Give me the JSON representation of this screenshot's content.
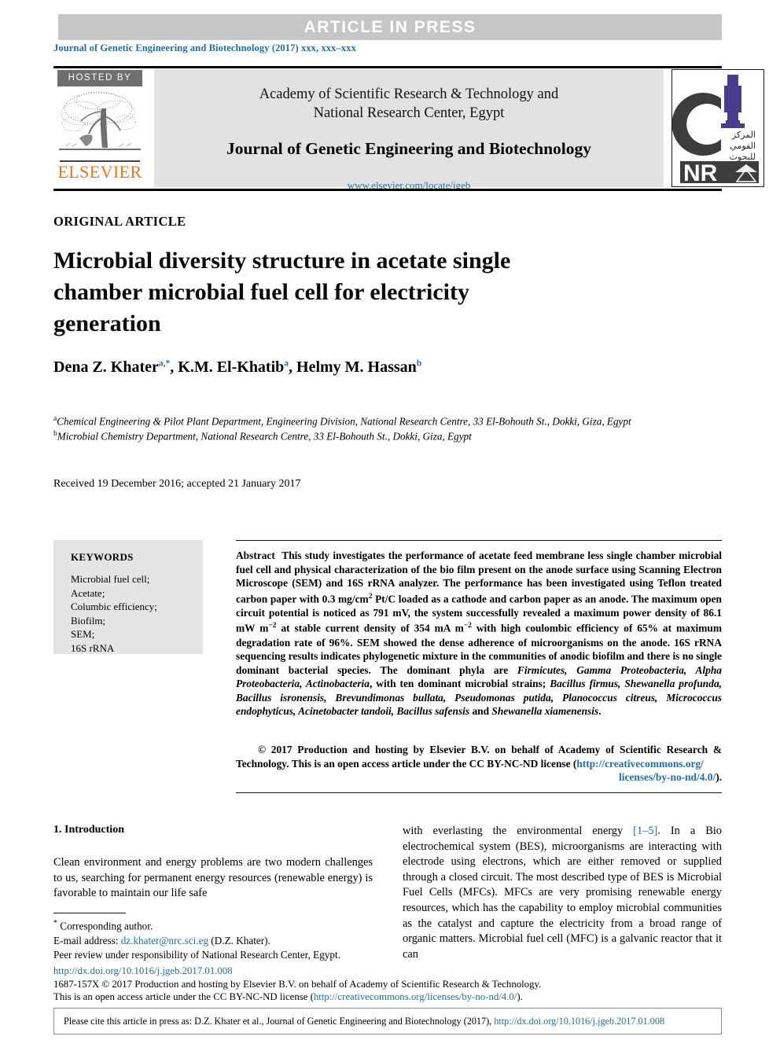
{
  "banner": {
    "text": "ARTICLE IN PRESS",
    "bg_color": "#c6c6c6"
  },
  "journal_reference": "Journal of Genetic Engineering and Biotechnology (2017) xxx, xxx–xxx",
  "masthead": {
    "hosted_by_label": "HOSTED BY",
    "publisher_name": "ELSEVIER",
    "society_line1": "Academy of Scientific Research & Technology and",
    "society_line2": "National Research Center, Egypt",
    "journal_title": "Journal of Genetic Engineering and Biotechnology",
    "journal_url": "www.elsevier.com/locate/jgeb",
    "nrc_arabic_line1": "المركز",
    "nrc_arabic_line2": "القومي",
    "nrc_arabic_line3": "للبحوث",
    "nrc_acronym": "NRC"
  },
  "article": {
    "type_label": "ORIGINAL ARTICLE",
    "title": "Microbial diversity structure in acetate single chamber microbial fuel cell for electricity generation",
    "authors": [
      {
        "name": "Dena Z. Khater",
        "marks": "a,*"
      },
      {
        "name": "K.M. El-Khatib",
        "marks": "a"
      },
      {
        "name": "Helmy M. Hassan",
        "marks": "b"
      }
    ],
    "affiliations": [
      {
        "mark": "a",
        "text": "Chemical Engineering & Pilot Plant Department, Engineering Division, National Research Centre, 33 El-Bohouth St., Dokki, Giza, Egypt"
      },
      {
        "mark": "b",
        "text": "Microbial Chemistry Department, National Research Centre, 33 El-Bohouth St., Dokki, Giza, Egypt"
      }
    ],
    "dates": "Received 19 December 2016; accepted 21 January 2017"
  },
  "keywords": {
    "heading": "KEYWORDS",
    "items": [
      "Microbial fuel cell;",
      "Acetate;",
      "Columbic efficiency;",
      "Biofilm;",
      "SEM;",
      "16S rRNA"
    ]
  },
  "abstract": {
    "label": "Abstract",
    "part1": "This study investigates the performance of acetate feed membrane less single chamber microbial fuel cell and physical characterization of the bio film present on the anode surface using Scanning Electron Microscope (SEM) and 16S rRNA analyzer. The performance has been investigated using Teflon treated carbon paper with 0.3 mg/cm",
    "sup1": "2",
    "part2": " Pt/C loaded as a cathode and carbon paper as an anode. The maximum open circuit potential is noticed as 791 mV, the system successfully revealed a maximum power density of 86.1 mW m",
    "sup2": "−2",
    "part3": " at stable current density of 354 mA m",
    "sup3": "−2",
    "part4": " with high coulombic efficiency of 65% at maximum degradation rate of 96%. SEM showed the dense adherence of microorganisms on the anode. 16S rRNA sequencing results indicates phylogenetic mixture in the communities of anodic biofilm and there is no single dominant bacterial species. The dominant phyla are ",
    "italic1": "Firmicutes, Gamma Proteobacteria, Alpha Proteobacteria, Actinobacteria",
    "part5": ", with ten dominant microbial strains; ",
    "italic2": "Bacillus firmus, Shewanella profunda, Bacillus isronensis, Brevundimonas bullata, Pseudomonas putida, Planococcus citreus, Micrococcus endophyticus, Acinetobacter tandoii, Bacillus safensis",
    "part6": " and ",
    "italic3": "Shewanella xiamenensis",
    "part7": "."
  },
  "copyright": {
    "text": "© 2017 Production and hosting by Elsevier B.V. on behalf of Academy of Scientific Research & Technology. This is an open access article under the CC BY-NC-ND license (",
    "license_url_line1": "http://creativecommons.org/",
    "license_url_line2": "licenses/by-no-nd/4.0/",
    "tail": ")."
  },
  "body": {
    "section_heading": "1. Introduction",
    "left_column": "Clean environment and energy problems are two modern challenges to us, searching for permanent energy resources (renewable energy) is favorable to maintain our life safe",
    "right_column_a": "with everlasting the environmental energy ",
    "right_column_ref": "[1–5]",
    "right_column_b": ". In a Bio electrochemical system (BES), microorganisms are interacting with electrode using electrons, which are either removed or supplied through a closed circuit. The most described type of BES is Microbial Fuel Cells (MFCs). MFCs are very promising renewable energy resources, which has the capability to employ microbial communities as the catalyst and capture the electricity from a broad range of organic matters. Microbial fuel cell (MFC) is a galvanic reactor that it can"
  },
  "footnotes": {
    "corresponding_mark": "*",
    "corresponding_text": "Corresponding author.",
    "email_label": "E-mail address:",
    "email": "dz.khater@nrc.sci.eg",
    "email_owner": "(D.Z. Khater).",
    "peer_review": "Peer review under responsibility of National Research Center, Egypt."
  },
  "bottom": {
    "doi": "http://dx.doi.org/10.1016/j.jgeb.2017.01.008",
    "issn_line": "1687-157X © 2017 Production and hosting by Elsevier B.V. on behalf of Academy of Scientific Research & Technology.",
    "license_line_prefix": "This is an open access article under the CC BY-NC-ND license (",
    "license_link": "http://creativecommons.org/licenses/by-no-nd/4.0/",
    "license_line_suffix": ")."
  },
  "citation_box": {
    "prefix": "Please cite this article in press as: D.Z. Khater et al.,  Journal of Genetic Engineering and Biotechnology (2017), ",
    "link": "http://dx.doi.org/10.1016/j.jgeb.2017.01.008"
  },
  "colors": {
    "link": "#1f6fa8",
    "elsevier_orange": "#e87722",
    "banner_grey": "#c6c6c6",
    "panel_grey": "#e2e2e2",
    "keyword_grey": "#e5e5e5",
    "nrc_purple": "#4b3c8f"
  }
}
